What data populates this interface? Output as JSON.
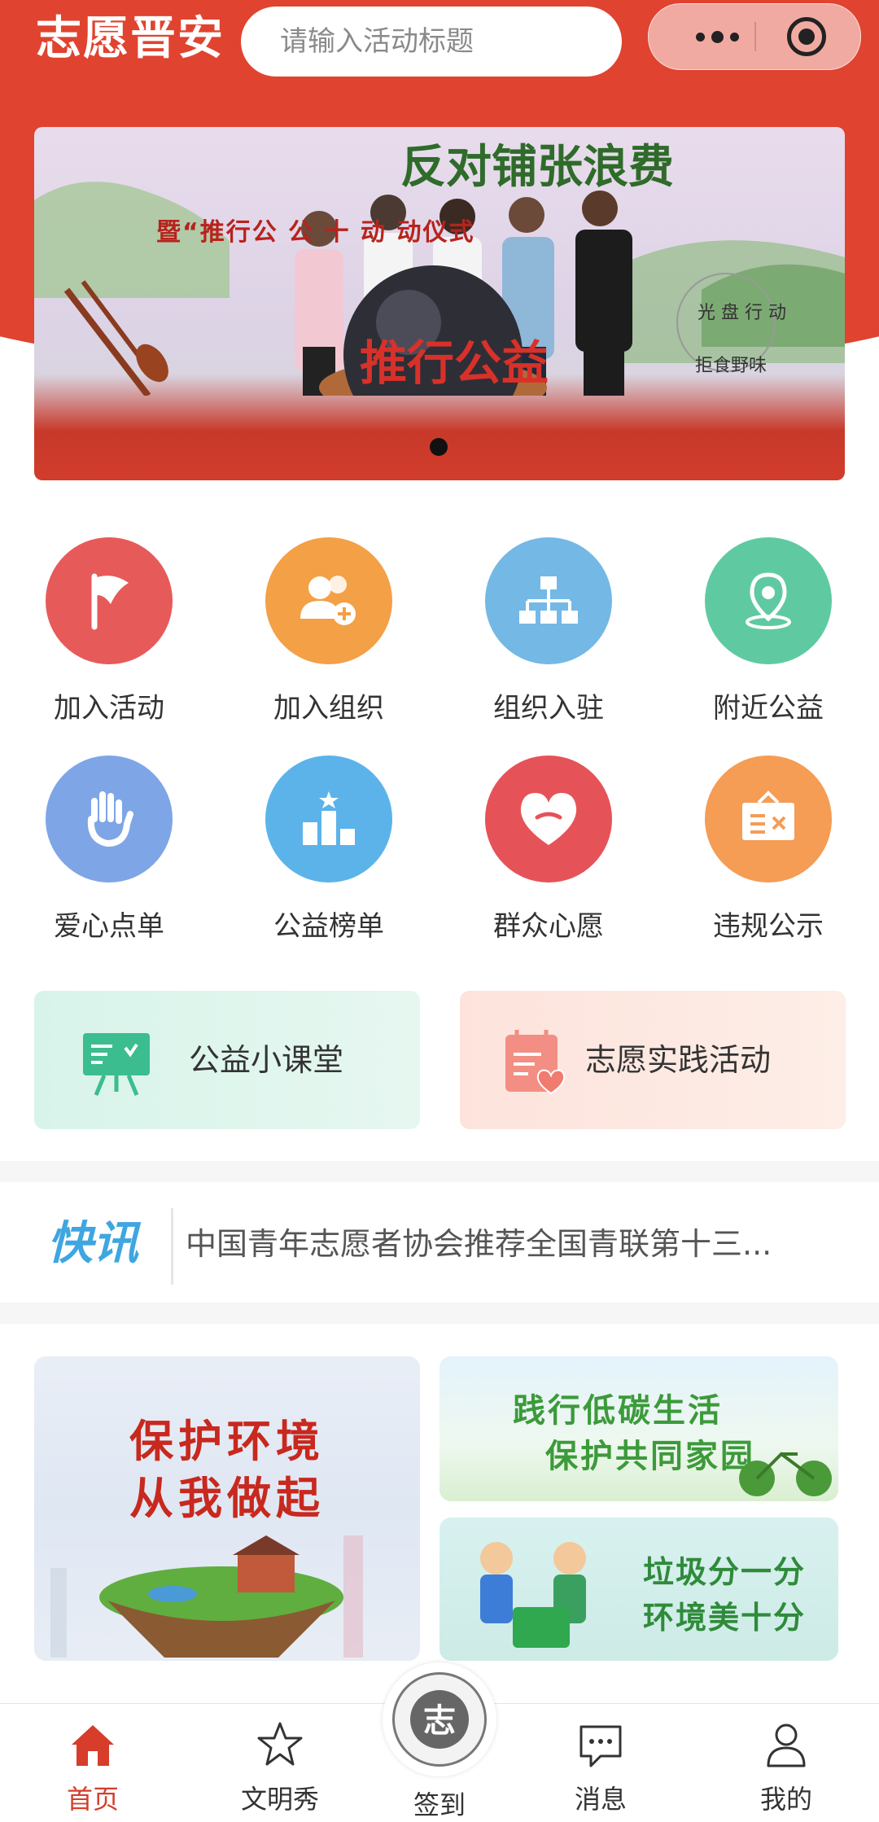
{
  "header": {
    "app_title": "志愿晋安",
    "search_placeholder": "请输入活动标题"
  },
  "banner": {
    "headline": "反对铺张浪费",
    "subline": "暨“推行公 公 十 动 动仪式",
    "sign_text": "光 盘 行 动",
    "sign_text2": "拒食野味",
    "podium_text": "推行公益"
  },
  "grid": [
    {
      "label": "加入活动",
      "icon": "flag-icon",
      "color": "#e75a5a"
    },
    {
      "label": "加入组织",
      "icon": "add-user-icon",
      "color": "#f3a046"
    },
    {
      "label": "组织入驻",
      "icon": "org-chart-icon",
      "color": "#74b8e6"
    },
    {
      "label": "附近公益",
      "icon": "location-icon",
      "color": "#5fcaa2"
    },
    {
      "label": "爱心点单",
      "icon": "hand-icon",
      "color": "#7ea6e6"
    },
    {
      "label": "公益榜单",
      "icon": "podium-icon",
      "color": "#5bb3ea"
    },
    {
      "label": "群众心愿",
      "icon": "heart-icon",
      "color": "#e55358"
    },
    {
      "label": "违规公示",
      "icon": "notice-board-icon",
      "color": "#f59c55"
    }
  ],
  "cards": [
    {
      "label": "公益小课堂",
      "icon": "easel-icon"
    },
    {
      "label": "志愿实践活动",
      "icon": "calendar-heart-icon"
    }
  ],
  "news": {
    "logo": "快讯",
    "text": "中国青年志愿者协会推荐全国青联第十三..."
  },
  "posters": {
    "p1_line1": "保护环境",
    "p1_line2": "从我做起",
    "p2_line1": "践行低碳生活",
    "p2_line2": "保护共同家园",
    "p3_line1": "垃圾分一分",
    "p3_line2": "环境美十分"
  },
  "tabbar": {
    "home": "首页",
    "show": "文明秀",
    "checkin": "签到",
    "messages": "消息",
    "mine": "我的",
    "active_color": "#d63d2b"
  },
  "badge_text": "志"
}
